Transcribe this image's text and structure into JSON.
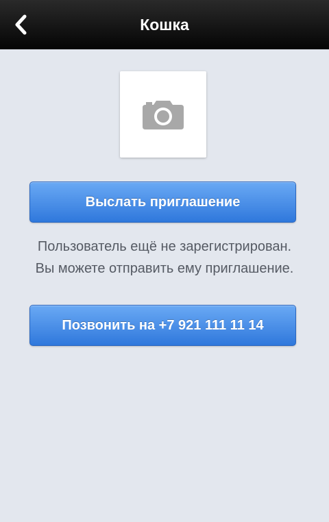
{
  "navbar": {
    "title": "Кошка",
    "back_icon": "chevron-left-icon"
  },
  "avatar": {
    "icon": "camera-icon"
  },
  "invite_button": {
    "label": "Выслать приглашение"
  },
  "message": {
    "line1": "Пользователь ещё не зарегистрирован.",
    "line2": "Вы можете отправить ему приглашение."
  },
  "call_button": {
    "label": "Позвонить на +7 921 111 11 14"
  },
  "colors": {
    "navbar": "#0d0d0d",
    "background": "#e3e7ee",
    "button_top": "#6aa9f4",
    "button_bottom": "#2f78dc",
    "camera_icon": "#a8a8a8"
  }
}
